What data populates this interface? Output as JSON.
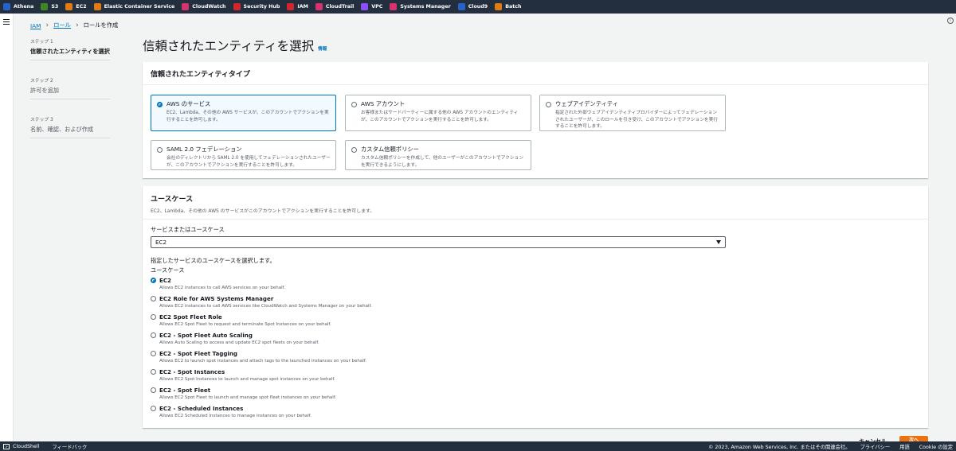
{
  "top_bar": {
    "favorites": [
      {
        "label": "Athena",
        "icon": "athena-icon",
        "color": "#2563c9"
      },
      {
        "label": "S3",
        "icon": "s3-icon",
        "color": "#3f8624"
      },
      {
        "label": "EC2",
        "icon": "ec2-icon",
        "color": "#e07b13"
      },
      {
        "label": "Elastic Container Service",
        "icon": "ecs-icon",
        "color": "#e07b13"
      },
      {
        "label": "CloudWatch",
        "icon": "cloudwatch-icon",
        "color": "#d6336c"
      },
      {
        "label": "Security Hub",
        "icon": "security-hub-icon",
        "color": "#d6242f"
      },
      {
        "label": "IAM",
        "icon": "iam-icon",
        "color": "#d6242f"
      },
      {
        "label": "CloudTrail",
        "icon": "cloudtrail-icon",
        "color": "#d6336c"
      },
      {
        "label": "VPC",
        "icon": "vpc-icon",
        "color": "#8c4fff"
      },
      {
        "label": "Systems Manager",
        "icon": "systems-manager-icon",
        "color": "#d6336c"
      },
      {
        "label": "Cloud9",
        "icon": "cloud9-icon",
        "color": "#2563c9"
      },
      {
        "label": "Batch",
        "icon": "batch-icon",
        "color": "#e07b13"
      }
    ]
  },
  "breadcrumb": {
    "items": [
      "IAM",
      "ロール"
    ],
    "current": "ロールを作成"
  },
  "steps": [
    {
      "num": "ステップ 1",
      "name": "信頼されたエンティティを選択",
      "active": true
    },
    {
      "num": "ステップ 2",
      "name": "許可を追加",
      "active": false
    },
    {
      "num": "ステップ 3",
      "name": "名前、確認、および作成",
      "active": false
    }
  ],
  "page": {
    "title": "信頼されたエンティティを選択",
    "info": "情報"
  },
  "entity_panel": {
    "title": "信頼されたエンティティタイプ",
    "tiles": [
      {
        "title": "AWS のサービス",
        "desc": "EC2、Lambda、その他の AWS サービスが、このアカウントでアクションを実行することを許可します。",
        "selected": true
      },
      {
        "title": "AWS アカウント",
        "desc": "お客様またはサードパーティーに属する他の AWS アカウントのエンティティが、このアカウントでアクションを実行することを許可します。",
        "selected": false
      },
      {
        "title": "ウェブアイデンティティ",
        "desc": "指定された外部ウェブアイデンティティプロバイダーによってフェデレーションされたユーザーが、このロールを引き受け、このアカウントでアクションを実行することを許可します。",
        "selected": false
      },
      {
        "title": "SAML 2.0 フェデレーション",
        "desc": "会社のディレクトリから SAML 2.0 を使用してフェデレーションされたユーザーが、このアカウントでアクションを実行することを許可します。",
        "selected": false
      },
      {
        "title": "カスタム信頼ポリシー",
        "desc": "カスタム信頼ポリシーを作成して、他のユーザーがこのアカウントでアクションを実行できるようにします。",
        "selected": false
      }
    ]
  },
  "usecase_panel": {
    "title": "ユースケース",
    "desc": "EC2、Lambda、その他の AWS のサービスがこのアカウントでアクションを実行することを許可します。",
    "service_label": "サービスまたはユースケース",
    "service_value": "EC2",
    "choose_label": "指定したサービスのユースケースを選択します。",
    "usecase_label": "ユースケース",
    "options": [
      {
        "title": "EC2",
        "desc": "Allows EC2 instances to call AWS services on your behalf.",
        "selected": true
      },
      {
        "title": "EC2 Role for AWS Systems Manager",
        "desc": "Allows EC2 instances to call AWS services like CloudWatch and Systems Manager on your behalf.",
        "selected": false
      },
      {
        "title": "EC2 Spot Fleet Role",
        "desc": "Allows EC2 Spot Fleet to request and terminate Spot Instances on your behalf.",
        "selected": false
      },
      {
        "title": "EC2 - Spot Fleet Auto Scaling",
        "desc": "Allows Auto Scaling to access and update EC2 spot fleets on your behalf.",
        "selected": false
      },
      {
        "title": "EC2 - Spot Fleet Tagging",
        "desc": "Allows EC2 to launch spot instances and attach tags to the launched instances on your behalf.",
        "selected": false
      },
      {
        "title": "EC2 - Spot Instances",
        "desc": "Allows EC2 Spot Instances to launch and manage spot instances on your behalf.",
        "selected": false
      },
      {
        "title": "EC2 - Spot Fleet",
        "desc": "Allows EC2 Spot Fleet to launch and manage spot fleet instances on your behalf.",
        "selected": false
      },
      {
        "title": "EC2 - Scheduled Instances",
        "desc": "Allows EC2 Scheduled Instances to manage instances on your behalf.",
        "selected": false
      }
    ]
  },
  "actions": {
    "cancel": "キャンセル",
    "next": "次へ"
  },
  "footer": {
    "cloudshell": "CloudShell",
    "feedback": "フィードバック",
    "copyright": "© 2023, Amazon Web Services, Inc. またはその関連会社。",
    "privacy": "プライバシー",
    "terms": "用語",
    "cookie": "Cookie の設定"
  }
}
